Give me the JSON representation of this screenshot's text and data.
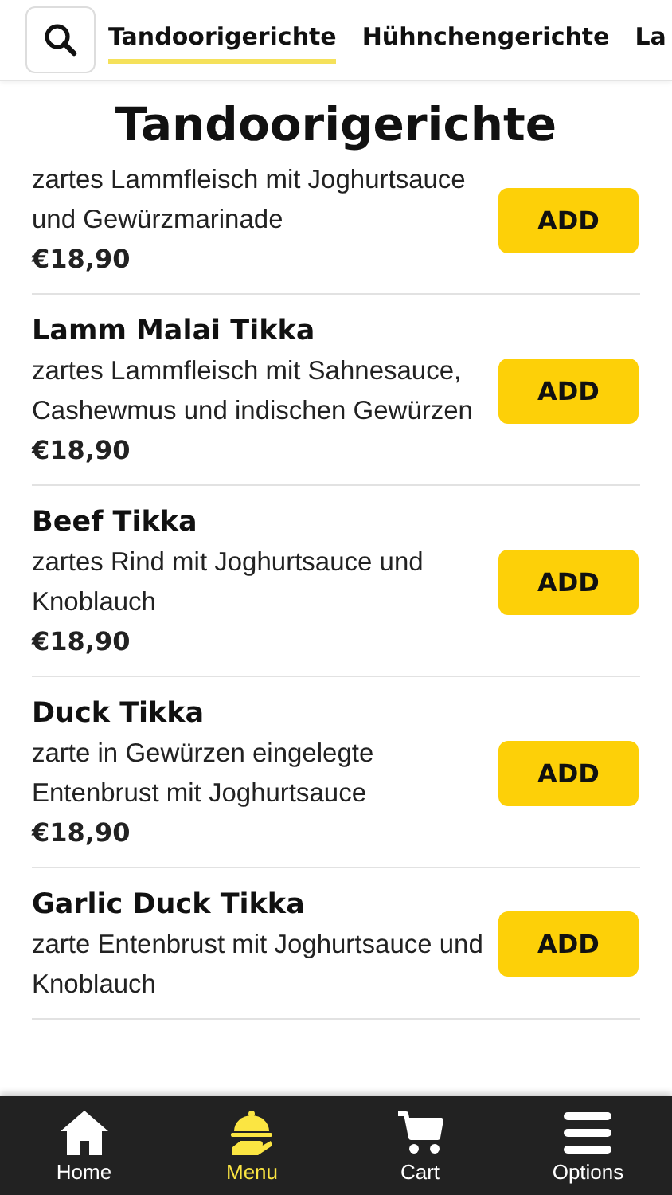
{
  "tabs": [
    {
      "label": "Tandoorigerichte",
      "selected": true
    },
    {
      "label": "Hühnchengerichte",
      "selected": false
    },
    {
      "label": "La",
      "selected": false
    }
  ],
  "section_title": "Tandoorigerichte",
  "items": [
    {
      "description": "zartes Lammfleisch mit Joghurtsauce und Gewürzmarinade",
      "price": "€18,90",
      "button": "ADD"
    },
    {
      "name": "Lamm Malai Tikka",
      "description": "zartes Lammfleisch mit Sahnesauce, Cashewmus und indischen Gewürzen",
      "price": "€18,90",
      "button": "ADD"
    },
    {
      "name": "Beef Tikka",
      "description": "zartes Rind mit Joghurtsauce und Knoblauch",
      "price": "€18,90",
      "button": "ADD"
    },
    {
      "name": "Duck Tikka",
      "description": "zarte in Gewürzen eingelegte Entenbrust mit Joghurtsauce",
      "price": "€18,90",
      "button": "ADD"
    },
    {
      "name": "Garlic Duck Tikka",
      "description": "zarte Entenbrust mit Joghurtsauce und Knoblauch",
      "button": "ADD"
    }
  ],
  "nav": [
    {
      "kind": "home",
      "label": "Home",
      "selected": false
    },
    {
      "kind": "menu",
      "label": "Menu",
      "selected": true
    },
    {
      "kind": "cart",
      "label": "Cart",
      "selected": false
    },
    {
      "kind": "options",
      "label": "Options",
      "selected": false
    }
  ]
}
